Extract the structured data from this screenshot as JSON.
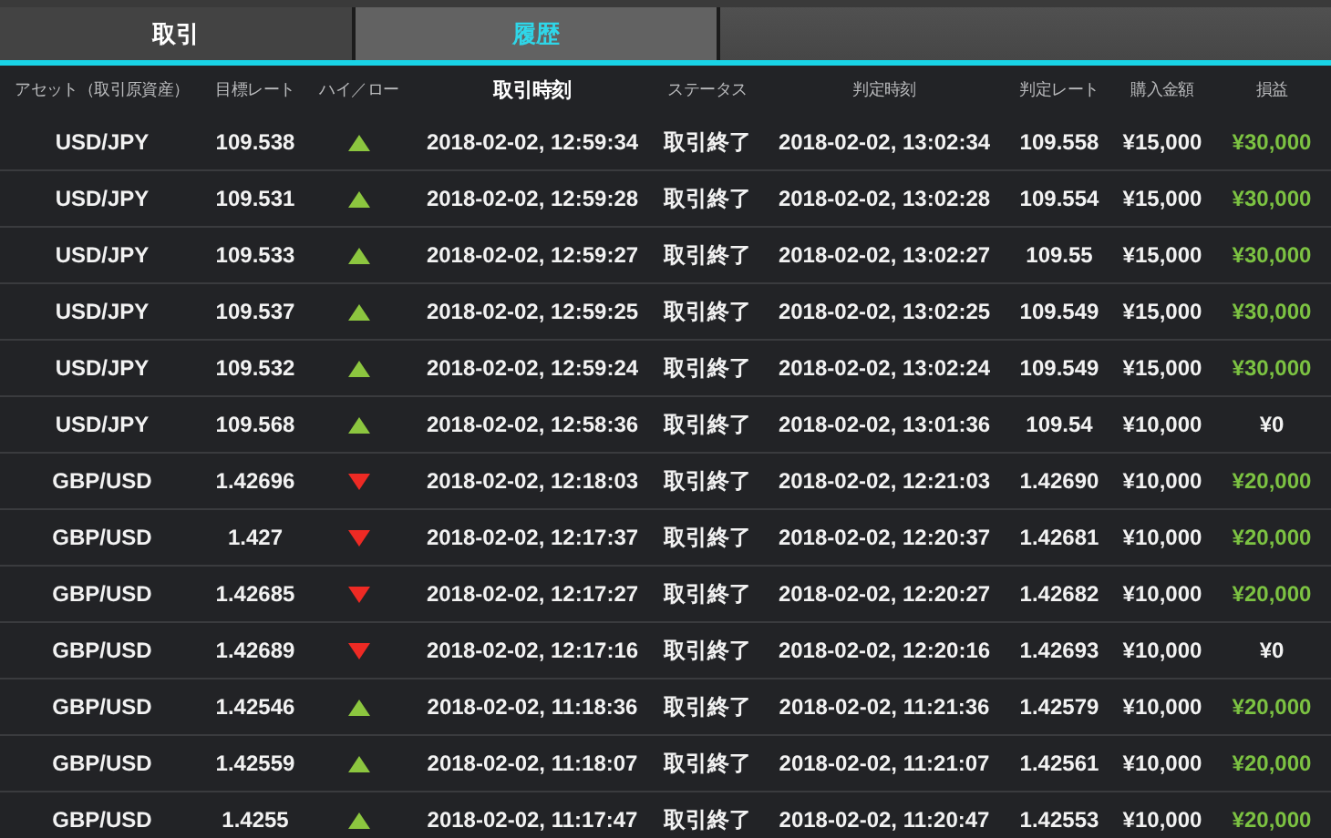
{
  "tabs": [
    {
      "label": "取引",
      "selected": false
    },
    {
      "label": "履歴",
      "selected": true
    }
  ],
  "table": {
    "columns": [
      {
        "label": "アセット（取引原資産）",
        "selected": false
      },
      {
        "label": "目標レート",
        "selected": false
      },
      {
        "label": "ハイ／ロー",
        "selected": false
      },
      {
        "label": "取引時刻",
        "selected": true
      },
      {
        "label": "ステータス",
        "selected": false
      },
      {
        "label": "判定時刻",
        "selected": false
      },
      {
        "label": "判定レート",
        "selected": false
      },
      {
        "label": "購入金額",
        "selected": false
      },
      {
        "label": "損益",
        "selected": false
      }
    ],
    "rows": [
      {
        "asset": "USD/JPY",
        "target_rate": "109.538",
        "kind": "high",
        "trade_time": "2018-02-02, 12:59:34",
        "status": "取引終了",
        "judge_time": "2018-02-02, 13:02:34",
        "judge_rate": "109.558",
        "amount": "¥15,000",
        "profit": "¥30,000",
        "gain": true
      },
      {
        "asset": "USD/JPY",
        "target_rate": "109.531",
        "kind": "high",
        "trade_time": "2018-02-02, 12:59:28",
        "status": "取引終了",
        "judge_time": "2018-02-02, 13:02:28",
        "judge_rate": "109.554",
        "amount": "¥15,000",
        "profit": "¥30,000",
        "gain": true
      },
      {
        "asset": "USD/JPY",
        "target_rate": "109.533",
        "kind": "high",
        "trade_time": "2018-02-02, 12:59:27",
        "status": "取引終了",
        "judge_time": "2018-02-02, 13:02:27",
        "judge_rate": "109.55",
        "amount": "¥15,000",
        "profit": "¥30,000",
        "gain": true
      },
      {
        "asset": "USD/JPY",
        "target_rate": "109.537",
        "kind": "high",
        "trade_time": "2018-02-02, 12:59:25",
        "status": "取引終了",
        "judge_time": "2018-02-02, 13:02:25",
        "judge_rate": "109.549",
        "amount": "¥15,000",
        "profit": "¥30,000",
        "gain": true
      },
      {
        "asset": "USD/JPY",
        "target_rate": "109.532",
        "kind": "high",
        "trade_time": "2018-02-02, 12:59:24",
        "status": "取引終了",
        "judge_time": "2018-02-02, 13:02:24",
        "judge_rate": "109.549",
        "amount": "¥15,000",
        "profit": "¥30,000",
        "gain": true
      },
      {
        "asset": "USD/JPY",
        "target_rate": "109.568",
        "kind": "high",
        "trade_time": "2018-02-02, 12:58:36",
        "status": "取引終了",
        "judge_time": "2018-02-02, 13:01:36",
        "judge_rate": "109.54",
        "amount": "¥10,000",
        "profit": "¥0",
        "gain": false
      },
      {
        "asset": "GBP/USD",
        "target_rate": "1.42696",
        "kind": "low",
        "trade_time": "2018-02-02, 12:18:03",
        "status": "取引終了",
        "judge_time": "2018-02-02, 12:21:03",
        "judge_rate": "1.42690",
        "amount": "¥10,000",
        "profit": "¥20,000",
        "gain": true
      },
      {
        "asset": "GBP/USD",
        "target_rate": "1.427",
        "kind": "low",
        "trade_time": "2018-02-02, 12:17:37",
        "status": "取引終了",
        "judge_time": "2018-02-02, 12:20:37",
        "judge_rate": "1.42681",
        "amount": "¥10,000",
        "profit": "¥20,000",
        "gain": true
      },
      {
        "asset": "GBP/USD",
        "target_rate": "1.42685",
        "kind": "low",
        "trade_time": "2018-02-02, 12:17:27",
        "status": "取引終了",
        "judge_time": "2018-02-02, 12:20:27",
        "judge_rate": "1.42682",
        "amount": "¥10,000",
        "profit": "¥20,000",
        "gain": true
      },
      {
        "asset": "GBP/USD",
        "target_rate": "1.42689",
        "kind": "low",
        "trade_time": "2018-02-02, 12:17:16",
        "status": "取引終了",
        "judge_time": "2018-02-02, 12:20:16",
        "judge_rate": "1.42693",
        "amount": "¥10,000",
        "profit": "¥0",
        "gain": false
      },
      {
        "asset": "GBP/USD",
        "target_rate": "1.42546",
        "kind": "high",
        "trade_time": "2018-02-02, 11:18:36",
        "status": "取引終了",
        "judge_time": "2018-02-02, 11:21:36",
        "judge_rate": "1.42579",
        "amount": "¥10,000",
        "profit": "¥20,000",
        "gain": true
      },
      {
        "asset": "GBP/USD",
        "target_rate": "1.42559",
        "kind": "high",
        "trade_time": "2018-02-02, 11:18:07",
        "status": "取引終了",
        "judge_time": "2018-02-02, 11:21:07",
        "judge_rate": "1.42561",
        "amount": "¥10,000",
        "profit": "¥20,000",
        "gain": true
      },
      {
        "asset": "GBP/USD",
        "target_rate": "1.4255",
        "kind": "high",
        "trade_time": "2018-02-02, 11:17:47",
        "status": "取引終了",
        "judge_time": "2018-02-02, 11:20:47",
        "judge_rate": "1.42553",
        "amount": "¥10,000",
        "profit": "¥20,000",
        "gain": true
      }
    ]
  }
}
